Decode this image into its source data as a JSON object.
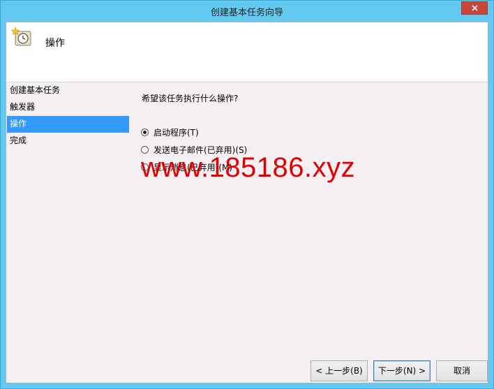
{
  "window": {
    "title": "创建基本任务向导"
  },
  "header": {
    "title": "操作"
  },
  "steps": [
    {
      "label": "创建基本任务"
    },
    {
      "label": "触发器"
    },
    {
      "label": "操作"
    },
    {
      "label": "完成"
    }
  ],
  "main": {
    "question": "希望该任务执行什么操作?",
    "options": [
      {
        "label": "启动程序(T)",
        "checked": true
      },
      {
        "label": "发送电子邮件(已弃用)(S)",
        "checked": false
      },
      {
        "label": "显示消息(已弃用)(M)",
        "checked": false
      }
    ],
    "watermark": "www.185186.xyz"
  },
  "buttons": {
    "back": "< 上一步(B)",
    "next": "下一步(N) >",
    "cancel": "取消"
  },
  "colors": {
    "titlebar": "#63c9f0",
    "close": "#c7463a",
    "selection": "#3399ff",
    "watermark": "#e00000"
  },
  "icons": {
    "header": "task-scheduler-clock-icon",
    "close": "close-icon"
  }
}
